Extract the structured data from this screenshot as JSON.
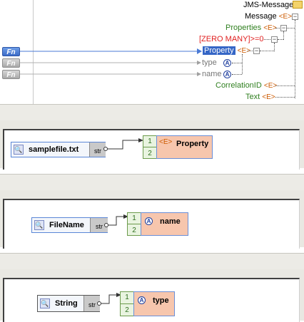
{
  "mapping": {
    "functions": [
      "Fn",
      "Fn",
      "Fn"
    ],
    "tree": {
      "root": "JMS-Message",
      "message": "Message",
      "properties": "Properties",
      "cardinality": "[ZERO MANY]",
      "cardinality_suffix": ">=0",
      "property": "Property",
      "type": "type",
      "name": "name",
      "correlation": "CorrelationID",
      "text": "Text",
      "element_tag": "<E>",
      "attr_tag": "A",
      "collapse_glyph": "−"
    }
  },
  "panels": [
    {
      "source": {
        "label": "samplefile.txt",
        "type": "str",
        "icon": "constant-icon"
      },
      "target": {
        "label": "Property",
        "tag": "<E>",
        "indices": [
          "1",
          "2"
        ]
      }
    },
    {
      "source": {
        "label": "FileName",
        "type": "str",
        "icon": "constant-icon"
      },
      "target": {
        "label": "name",
        "tag": "A",
        "indices": [
          "1",
          "2"
        ]
      }
    },
    {
      "source": {
        "label": "String",
        "type": "str",
        "icon": "constant-icon"
      },
      "target": {
        "label": "type",
        "tag": "A",
        "indices": [
          "1",
          "2"
        ]
      }
    }
  ],
  "colors": {
    "accent": "#3566c6",
    "target_fill": "#f7c6ad",
    "index_fill": "#e9f4e0",
    "panel_bg": "#e9e8e2"
  }
}
